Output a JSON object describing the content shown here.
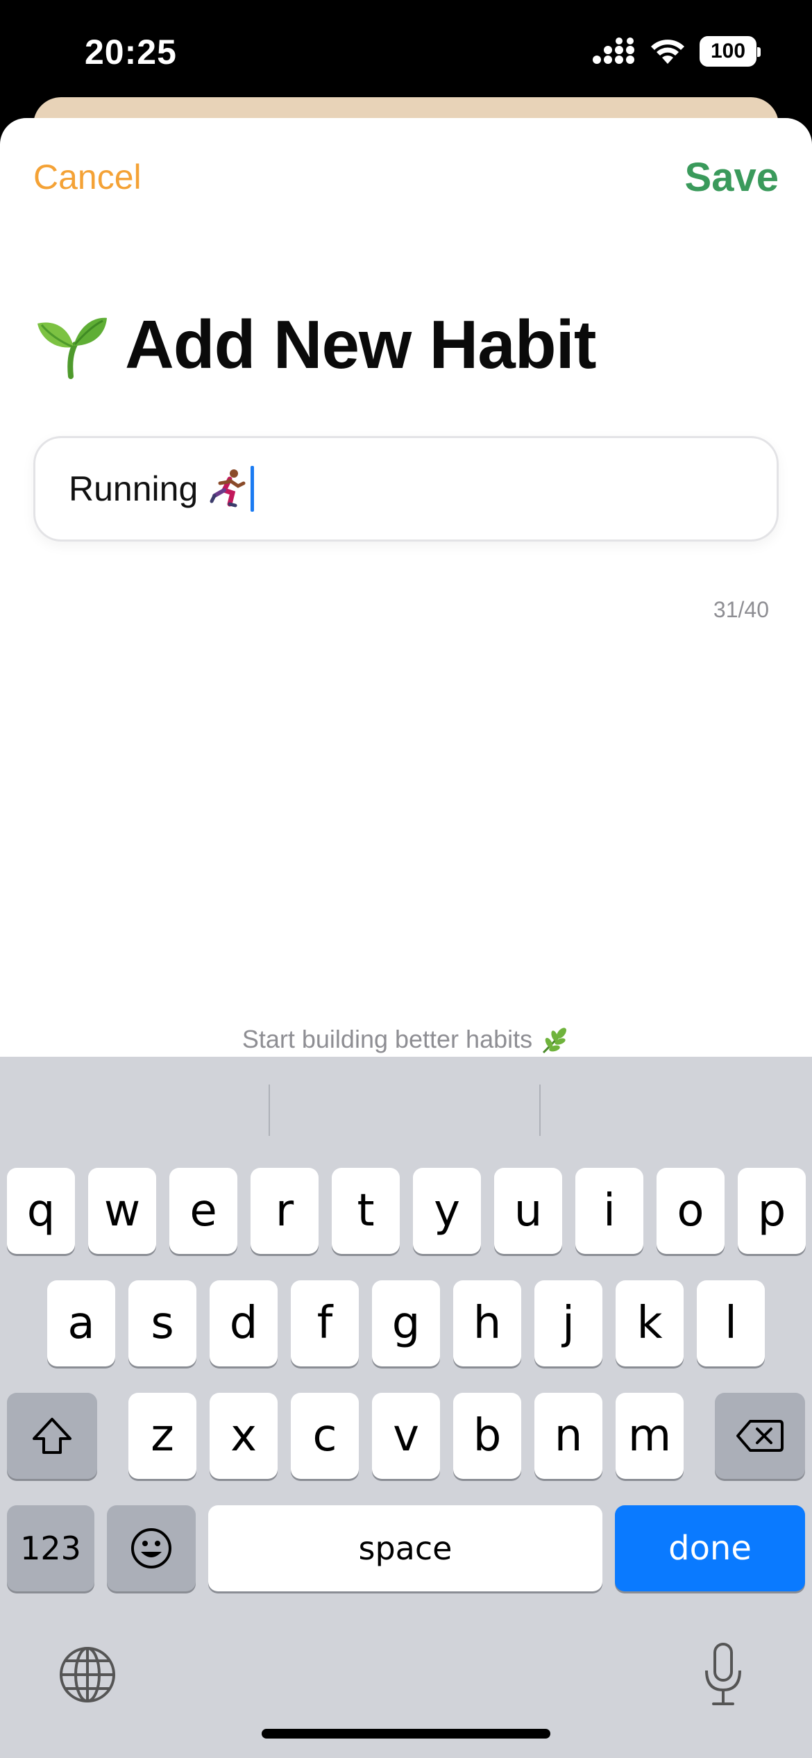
{
  "status_bar": {
    "time": "20:25",
    "battery": "100"
  },
  "nav": {
    "cancel_label": "Cancel",
    "save_label": "Save"
  },
  "header": {
    "title": "Add New Habit",
    "emoji_icon": "seedling-icon"
  },
  "habit_input": {
    "value": "Running",
    "emoji_icon": "runner-icon",
    "counter": "31/40"
  },
  "footer": {
    "text": "Start building better habits",
    "emoji_icon": "herb-icon"
  },
  "keyboard": {
    "row1": [
      "q",
      "w",
      "e",
      "r",
      "t",
      "y",
      "u",
      "i",
      "o",
      "p"
    ],
    "row2": [
      "a",
      "s",
      "d",
      "f",
      "g",
      "h",
      "j",
      "k",
      "l"
    ],
    "row3": [
      "z",
      "x",
      "c",
      "v",
      "b",
      "n",
      "m"
    ],
    "num_label": "123",
    "space_label": "space",
    "done_label": "done"
  },
  "colors": {
    "cancel": "#f4a236",
    "save": "#3a9a5b",
    "done": "#0a7aff",
    "caret": "#1b7bf2"
  }
}
